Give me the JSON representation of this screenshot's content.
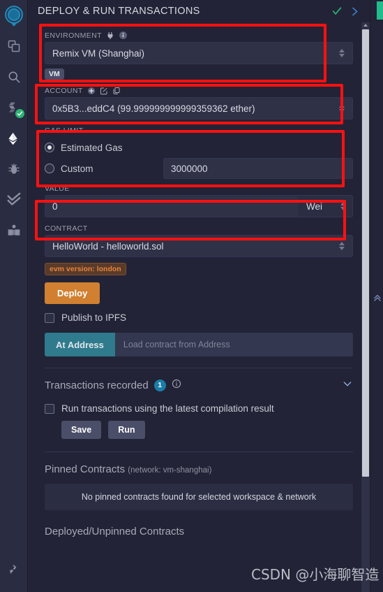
{
  "colors": {
    "panel_bg": "#222336",
    "iconbar_bg": "#2a2c41",
    "input_bg": "#2f3147",
    "accent_orange": "#d08030",
    "accent_teal": "#2f7a8c",
    "annotation_red": "#fd1111",
    "badge_blue": "#1a7ea8",
    "success_green": "#2bb673",
    "evm_badge_text": "#e2833c"
  },
  "iconbar": {
    "items": [
      {
        "name": "remix-logo-icon",
        "label": "Remix"
      },
      {
        "name": "file-explorer-icon",
        "label": "File explorer"
      },
      {
        "name": "search-icon",
        "label": "Search in files"
      },
      {
        "name": "solidity-compiler-icon",
        "label": "Solidity compiler",
        "status": "compiled-ok"
      },
      {
        "name": "deploy-run-icon",
        "label": "Deploy & run transactions",
        "active": true
      },
      {
        "name": "debugger-icon",
        "label": "Debugger"
      },
      {
        "name": "solidity-unit-testing-icon",
        "label": "Solidity unit testing"
      },
      {
        "name": "learneth-icon",
        "label": "LearnEth"
      },
      {
        "name": "plugin-manager-icon",
        "label": "Plugin manager"
      }
    ]
  },
  "header": {
    "title": "DEPLOY & RUN TRANSACTIONS",
    "check_icon": "check-icon",
    "expand_icon": "chevron-right-icon"
  },
  "environment": {
    "label": "ENVIRONMENT",
    "plug_icon": "plug-icon",
    "info_icon": "info-icon",
    "selected": "Remix VM (Shanghai)",
    "badge": "VM"
  },
  "account": {
    "label": "ACCOUNT",
    "add_icon": "plus-circle-icon",
    "edit_icon": "pencil-square-icon",
    "copy_icon": "copy-icon",
    "selected": "0x5B3...eddC4 (99.999999999999359362 ether)"
  },
  "gas_limit": {
    "label": "GAS LIMIT",
    "options": [
      {
        "label": "Estimated Gas",
        "selected": true
      },
      {
        "label": "Custom",
        "selected": false
      }
    ],
    "custom_value": "3000000"
  },
  "value": {
    "label": "VALUE",
    "amount": "0",
    "unit": "Wei"
  },
  "contract": {
    "label": "CONTRACT",
    "selected": "HelloWorld - helloworld.sol",
    "evm_version_badge": "evm version: london",
    "deploy_button": "Deploy",
    "publish_ipfs_label": "Publish to IPFS",
    "publish_ipfs_checked": false,
    "at_address_button": "At Address",
    "at_address_placeholder": "Load contract from Address"
  },
  "transactions": {
    "title": "Transactions recorded",
    "count": "1",
    "info_icon": "info-circle-icon",
    "collapse_icon": "chevron-down-icon",
    "run_latest_label": "Run transactions using the latest compilation result",
    "run_latest_checked": false,
    "save_button": "Save",
    "run_button": "Run"
  },
  "pinned": {
    "title": "Pinned Contracts",
    "network": "(network: vm-shanghai)",
    "empty_message": "No pinned contracts found for selected workspace & network"
  },
  "deployed": {
    "title": "Deployed/Unpinned Contracts"
  },
  "right_rail": {
    "scroll_up_icon": "chevrons-up-icon"
  },
  "watermark": {
    "text": "CSDN @小海聊智造"
  }
}
